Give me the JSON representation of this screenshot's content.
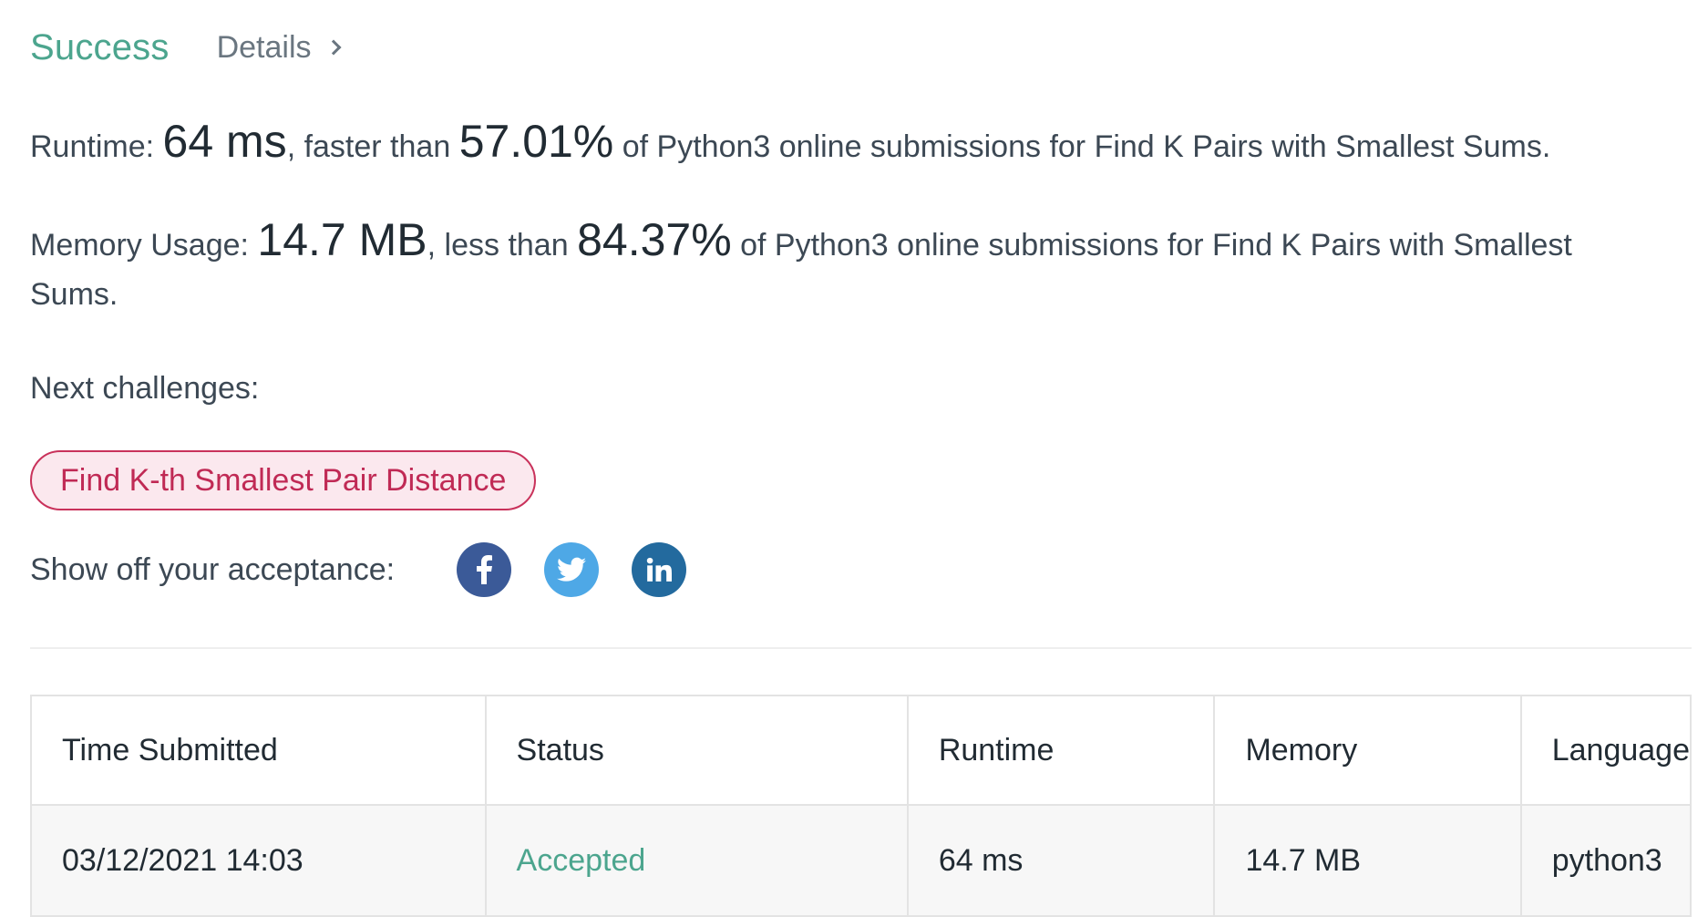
{
  "header": {
    "status": "Success",
    "details_label": "Details"
  },
  "runtime_line": {
    "label": "Runtime:",
    "value": "64 ms",
    "comparison": ", faster than",
    "percent": "57.01%",
    "suffix": "of Python3 online submissions for Find K Pairs with Smallest Sums."
  },
  "memory_line": {
    "label": "Memory Usage:",
    "value": "14.7 MB",
    "comparison": ", less than",
    "percent": "84.37%",
    "suffix": "of Python3 online submissions for Find K Pairs with Smallest Sums."
  },
  "next_challenges": {
    "label": "Next challenges:",
    "items": [
      "Find K-th Smallest Pair Distance"
    ]
  },
  "share": {
    "label": "Show off your acceptance:",
    "icons": [
      "facebook-icon",
      "twitter-icon",
      "linkedin-icon"
    ],
    "colors": {
      "facebook": "#3b5a98",
      "twitter": "#4ea8e6",
      "linkedin": "#236a9e"
    }
  },
  "table": {
    "headers": [
      "Time Submitted",
      "Status",
      "Runtime",
      "Memory",
      "Language"
    ],
    "rows": [
      [
        "03/12/2021 14:03",
        "Accepted",
        "64 ms",
        "14.7 MB",
        "python3"
      ]
    ]
  },
  "colors": {
    "success": "#4ca58e",
    "challenge_pill_text": "#c02a55",
    "challenge_pill_bg": "#fbe8ee"
  }
}
